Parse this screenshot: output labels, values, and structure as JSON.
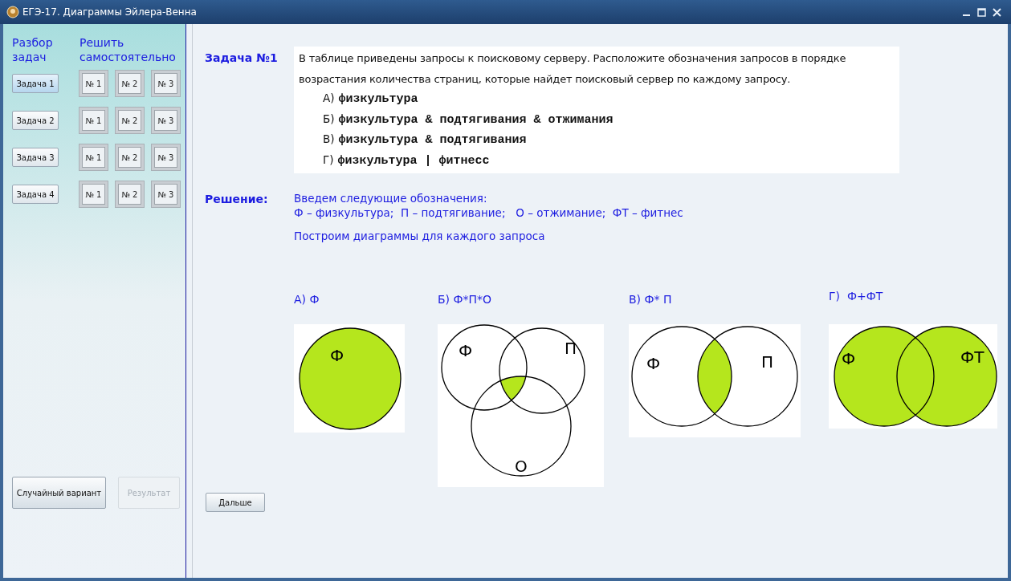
{
  "window": {
    "title": "ЕГЭ-17. Диаграммы Эйлера-Венна"
  },
  "sidebar": {
    "analysis_heading": "Разбор задач",
    "practice_heading": "Решить самостоятельно",
    "rows": [
      {
        "task": {
          "label": "Задача 1",
          "selected": true
        },
        "practice": [
          "№ 1",
          "№ 2",
          "№ 3"
        ]
      },
      {
        "task": {
          "label": "Задача 2",
          "selected": false
        },
        "practice": [
          "№ 1",
          "№ 2",
          "№ 3"
        ]
      },
      {
        "task": {
          "label": "Задача 3",
          "selected": false
        },
        "practice": [
          "№ 1",
          "№ 2",
          "№ 3"
        ]
      },
      {
        "task": {
          "label": "Задача 4",
          "selected": false
        },
        "practice": [
          "№ 1",
          "№ 2",
          "№ 3"
        ]
      }
    ],
    "random_button": {
      "label": "Случайный вариант",
      "disabled": false
    },
    "result_button": {
      "label": "Результат",
      "disabled": true
    }
  },
  "task": {
    "label": "Задача №1",
    "text": "В таблице приведены запросы к поисковому серверу. Расположите обозначения запросов в порядке возрастания количества страниц, которые найдет поисковый сервер по каждому запросу.",
    "queries": [
      {
        "letter": "А)",
        "query": "физкультура"
      },
      {
        "letter": "Б)",
        "query": "физкультура & подтягивания & отжимания"
      },
      {
        "letter": "В)",
        "query": "физкультура & подтягивания"
      },
      {
        "letter": "Г)",
        "query": "физкультура | фитнесс"
      }
    ]
  },
  "solution": {
    "label": "Решение:",
    "lines": [
      "Введем следующие обозначения:",
      "Ф – физкультура;  П – подтягивание;   О – отжимание;  ФТ – фитнес",
      "Построим диаграммы для каждого запроса"
    ]
  },
  "diagrams": [
    {
      "title": "А) Ф",
      "kind": "single",
      "sets": [
        "Ф"
      ]
    },
    {
      "title": "Б) Ф*П*О",
      "kind": "triple-intersection",
      "sets": [
        "Ф",
        "П",
        "О"
      ]
    },
    {
      "title": "В) Ф* П",
      "kind": "double-intersection",
      "sets": [
        "Ф",
        "П"
      ]
    },
    {
      "title": "Г)  Ф+ФТ",
      "kind": "double-union",
      "sets": [
        "Ф",
        "ФТ"
      ]
    }
  ],
  "next_button": "Дальше"
}
